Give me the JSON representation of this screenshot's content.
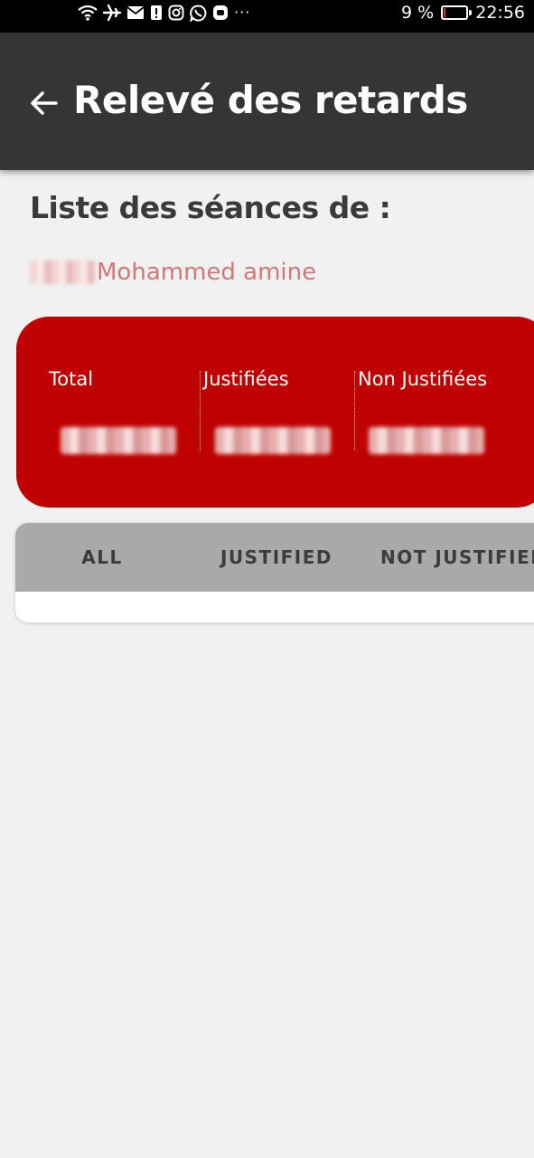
{
  "status_bar": {
    "battery_percent": "9 %",
    "battery_level": 0.09,
    "time": "22:56",
    "more_indicator": "···",
    "icons": [
      "wifi-icon",
      "airplane-icon",
      "mail-icon",
      "alert-icon",
      "instagram-icon",
      "whatsapp-icon",
      "messenger-icon"
    ]
  },
  "app_bar": {
    "title": "Relevé des retards",
    "back_icon": "arrow-left-icon"
  },
  "content": {
    "section_title": "Liste des séances de :",
    "student_name": "Mohammed amine"
  },
  "stats": {
    "total_label": "Total",
    "justified_label": "Justifiées",
    "non_justified_label": "Non Justifiées"
  },
  "tabs": [
    {
      "label": "ALL"
    },
    {
      "label": "JUSTIFIED"
    },
    {
      "label": "NOT JUSTIFIED"
    }
  ],
  "colors": {
    "app_bar": "#353535",
    "accent_red": "#bf0101",
    "name_color": "#d47777",
    "tabs_bar": "#a9a9a9"
  }
}
